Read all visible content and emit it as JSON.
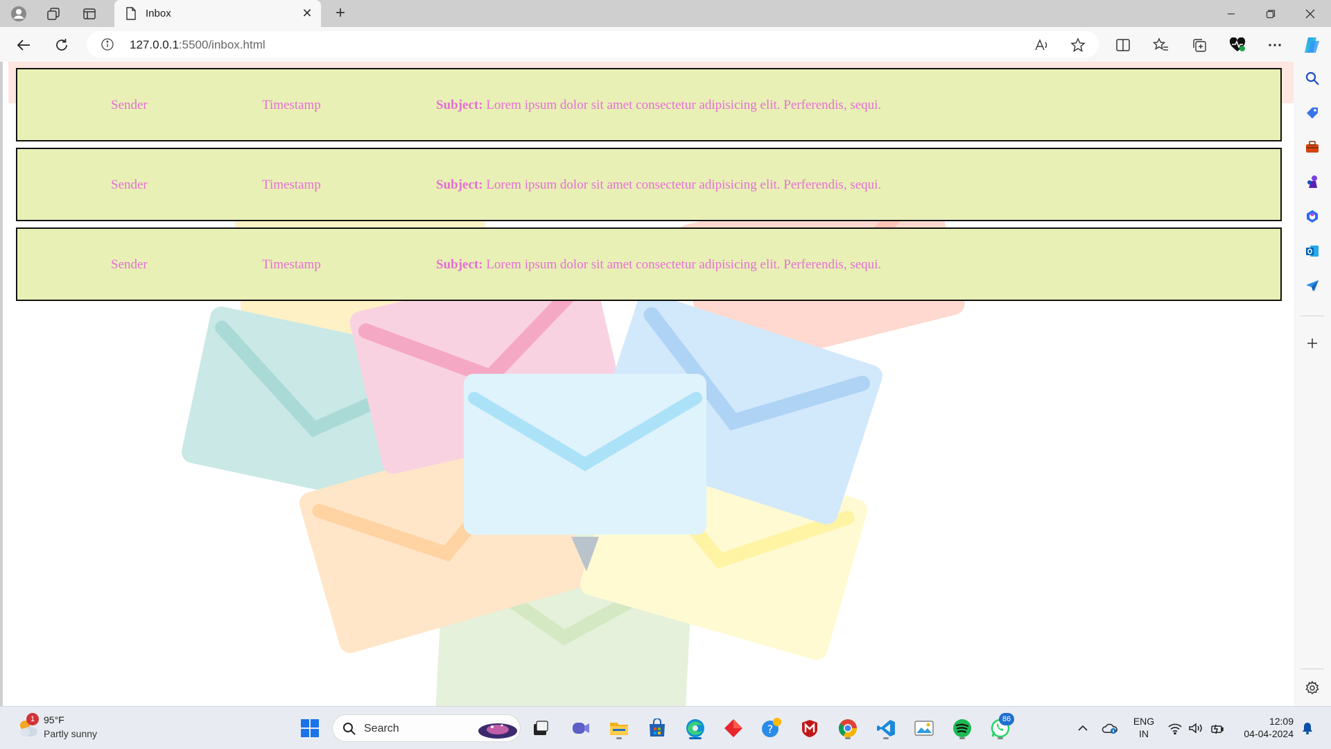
{
  "browser": {
    "tab_title": "Inbox",
    "url_host": "127.0.0.1",
    "url_rest": ":5500/inbox.html"
  },
  "inbox": {
    "rows": [
      {
        "sender": "Sender",
        "timestamp": "Timestamp",
        "subject_label": "Subject:",
        "subject_text": "Lorem ipsum dolor sit amet consectetur adipisicing elit. Perferendis, sequi."
      },
      {
        "sender": "Sender",
        "timestamp": "Timestamp",
        "subject_label": "Subject:",
        "subject_text": "Lorem ipsum dolor sit amet consectetur adipisicing elit. Perferendis, sequi."
      },
      {
        "sender": "Sender",
        "timestamp": "Timestamp",
        "subject_label": "Subject:",
        "subject_text": "Lorem ipsum dolor sit amet consectetur adipisicing elit. Perferendis, sequi."
      }
    ],
    "colors": {
      "row_bg": "#e9f0b5",
      "row_text": "#e46fd6",
      "row_border": "#111111"
    }
  },
  "taskbar": {
    "weather_temp": "95°F",
    "weather_desc": "Partly sunny",
    "weather_badge": "1",
    "search_label": "Search",
    "whatsapp_badge": "86",
    "lang_line1": "ENG",
    "lang_line2": "IN",
    "time": "12:09",
    "date": "04-04-2024"
  },
  "icons": [
    "profile-icon",
    "workspaces-icon",
    "vertical-tabs-icon",
    "page-icon",
    "close-icon",
    "plus-icon",
    "minimize-icon",
    "restore-icon",
    "back-icon",
    "refresh-icon",
    "info-icon",
    "read-aloud-icon",
    "favorite-star-icon",
    "split-screen-icon",
    "favorites-icon",
    "collections-icon",
    "browser-essentials-icon",
    "more-icon",
    "copilot-icon",
    "search-icon",
    "shopping-icon",
    "tools-icon",
    "games-icon",
    "microsoft365-icon",
    "outlook-icon",
    "send-icon",
    "settings-icon",
    "windows-start-icon",
    "weather-icon"
  ]
}
